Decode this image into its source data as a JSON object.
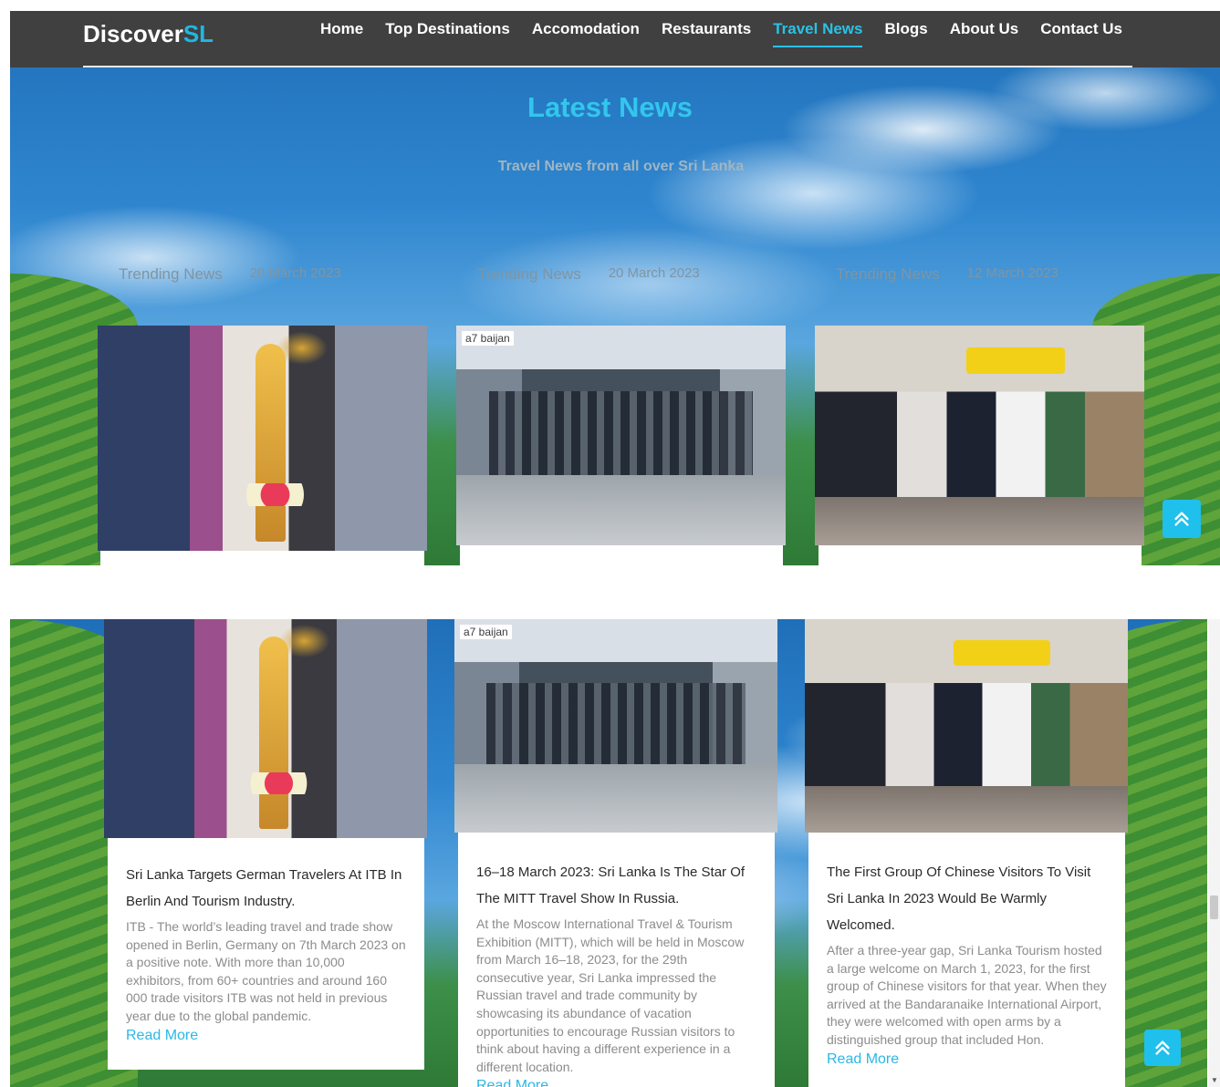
{
  "brand": {
    "name_main": "Discover",
    "name_accent": "SL"
  },
  "nav": {
    "items": [
      {
        "label": "Home",
        "active": false
      },
      {
        "label": "Top Destinations",
        "active": false
      },
      {
        "label": "Accomodation",
        "active": false
      },
      {
        "label": "Restaurants",
        "active": false
      },
      {
        "label": "Travel News",
        "active": true
      },
      {
        "label": "Blogs",
        "active": false
      },
      {
        "label": "About Us",
        "active": false
      },
      {
        "label": "Contact Us",
        "active": false
      }
    ]
  },
  "hero": {
    "title": "Latest News",
    "subtitle": "Travel News from all over Sri Lanka"
  },
  "preview_cards": [
    {
      "tag": "Trending News",
      "date": "20 March 2023"
    },
    {
      "tag": "Trending News",
      "date": "20 March 2023"
    },
    {
      "tag": "Trending News",
      "date": "12 March 2023"
    }
  ],
  "photo_labels": {
    "expo_banner": "a7  baijan"
  },
  "articles": [
    {
      "title": "Sri Lanka Targets German Travelers At ITB In Berlin And Tourism Industry.",
      "excerpt": "ITB - The world’s leading travel and trade show opened in Berlin, Germany on 7th March 2023 on a positive note. With more than 10,000 exhibitors, from 60+ countries and around 160 000 trade visitors ITB was not held in previous year due to the global pandemic.",
      "link": "Read More"
    },
    {
      "title": "16–18 March 2023: Sri Lanka Is The Star Of The MITT Travel Show In Russia.",
      "excerpt": "At the Moscow International Travel & Tourism Exhibition (MITT), which will be held in Moscow from March 16–18, 2023, for the 29th consecutive year, Sri Lanka impressed the Russian travel and trade community by showcasing its abundance of vacation opportunities to encourage Russian visitors to think about having a different experience in a different location.",
      "link": "Read More"
    },
    {
      "title": "The First Group Of Chinese Visitors To Visit Sri Lanka In 2023 Would Be Warmly Welcomed.",
      "excerpt": "After a three-year gap, Sri Lanka Tourism hosted a large welcome on March 1, 2023, for the first group of Chinese visitors for that year. When they arrived at the Bandaranaike International Airport, they were welcomed with open arms by a distinguished group that included Hon.",
      "link": "Read More"
    }
  ],
  "icons": {
    "scroll_top": "double-chevron-up-icon"
  },
  "colors": {
    "accent": "#29c2e8",
    "navbar": "#404040",
    "link": "#29b8e6"
  }
}
